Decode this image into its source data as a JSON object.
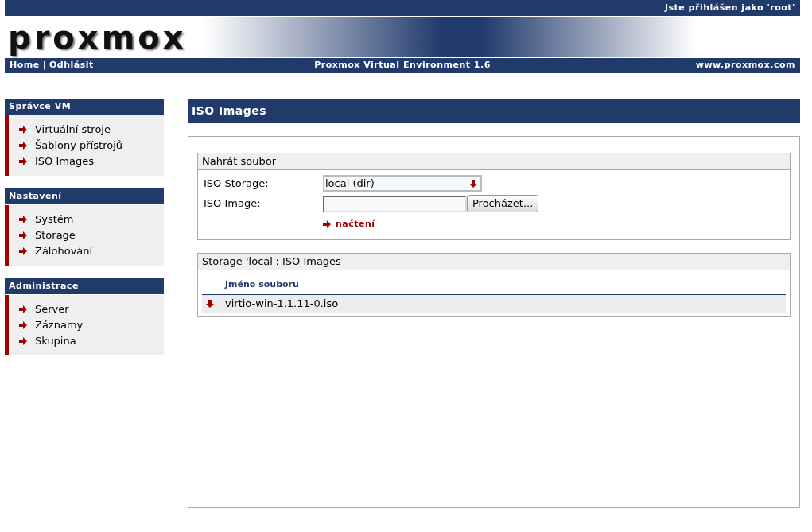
{
  "header": {
    "user_status": "Jste přihlášen jako 'root'",
    "logo": "proxmox",
    "nav_links": [
      "Home",
      "Odhlásit"
    ],
    "nav_separator": "|",
    "product": "Proxmox Virtual Environment 1.6",
    "website": "www.proxmox.com"
  },
  "sidebar": [
    {
      "title": "Správce VM",
      "items": [
        "Virtuální stroje",
        "Šablony přístrojů",
        "ISO Images"
      ]
    },
    {
      "title": "Nastavení",
      "items": [
        "Systém",
        "Storage",
        "Zálohování"
      ]
    },
    {
      "title": "Administrace",
      "items": [
        "Server",
        "Záznamy",
        "Skupina"
      ]
    }
  ],
  "page_title": "ISO Images",
  "upload": {
    "title": "Nahrát soubor",
    "storage_label": "ISO Storage:",
    "storage_value": "local (dir)",
    "image_label": "ISO Image:",
    "browse_button": "Procházet...",
    "upload_link": "načtení"
  },
  "storage_list": {
    "title": "Storage 'local': ISO Images",
    "column": "Jméno souboru",
    "rows": [
      "virtio-win-1.1.11-0.iso"
    ]
  }
}
